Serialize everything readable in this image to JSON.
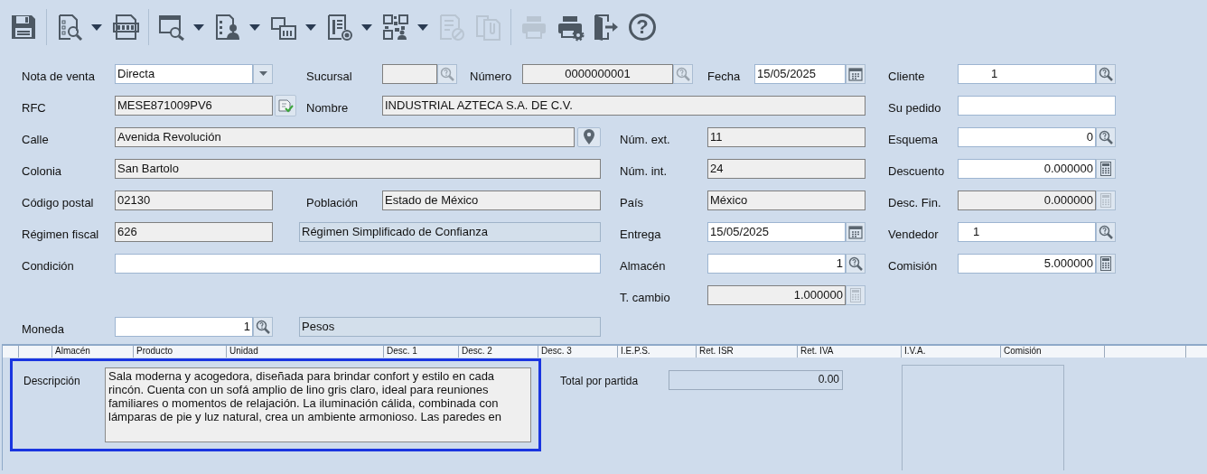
{
  "toolbar": {
    "groups": [
      [
        {
          "disabled": false,
          "dropdown": false
        }
      ],
      [
        {
          "disabled": false,
          "dropdown": true
        },
        {
          "disabled": false,
          "dropdown": false
        }
      ],
      [
        {
          "disabled": false,
          "dropdown": true
        },
        {
          "disabled": false,
          "dropdown": true
        },
        {
          "disabled": false,
          "dropdown": true
        },
        {
          "disabled": false,
          "dropdown": true
        },
        {
          "disabled": false,
          "dropdown": true
        },
        {
          "disabled": true,
          "dropdown": false
        },
        {
          "disabled": true,
          "dropdown": false
        }
      ],
      [
        {
          "disabled": true,
          "dropdown": false
        },
        {
          "disabled": false,
          "dropdown": false
        },
        {
          "disabled": false,
          "dropdown": false
        },
        {
          "disabled": false,
          "dropdown": false,
          "label": "?"
        }
      ]
    ]
  },
  "form": [
    {
      "kind": "label",
      "text": "Nota de venta"
    },
    {
      "kind": "combo",
      "value": "Directa",
      "readonly": false
    },
    {
      "kind": "label",
      "text": "Sucursal"
    },
    {
      "kind": "lookup",
      "readonly": true
    },
    {
      "kind": "label",
      "text": "Número"
    },
    {
      "kind": "lookup",
      "value": "0000000001",
      "readonly": true
    },
    {
      "kind": "label",
      "text": "Fecha"
    },
    {
      "kind": "date",
      "value": "15/05/2025",
      "readonly": false
    },
    {
      "kind": "label",
      "text": "Cliente"
    },
    {
      "kind": "lookup",
      "value": "1",
      "readonly": false
    },
    {
      "kind": "label",
      "text": "RFC"
    },
    {
      "kind": "text",
      "value": "MESE871009PV6",
      "readonly": true
    },
    {
      "kind": "check-button"
    },
    {
      "kind": "label",
      "text": "Nombre"
    },
    {
      "kind": "text",
      "value": "INDUSTRIAL AZTECA S.A. DE C.V.",
      "readonly": true
    },
    {
      "kind": "label",
      "text": "Su pedido"
    },
    {
      "kind": "text",
      "readonly": false
    },
    {
      "kind": "label",
      "text": "Calle"
    },
    {
      "kind": "pin",
      "value": "Avenida Revolución",
      "readonly": true
    },
    {
      "kind": "label",
      "text": "Núm. ext."
    },
    {
      "kind": "text",
      "value": "11",
      "readonly": true
    },
    {
      "kind": "label",
      "text": "Esquema"
    },
    {
      "kind": "lookup",
      "value": "0",
      "readonly": false
    },
    {
      "kind": "label",
      "text": "Colonia"
    },
    {
      "kind": "text",
      "value": "San Bartolo",
      "readonly": true
    },
    {
      "kind": "label",
      "text": "Núm. int."
    },
    {
      "kind": "text",
      "value": "24",
      "readonly": true
    },
    {
      "kind": "label",
      "text": "Descuento"
    },
    {
      "kind": "calc",
      "value": "0.000000",
      "readonly": false
    },
    {
      "kind": "label",
      "text": "Código postal"
    },
    {
      "kind": "text",
      "value": "02130",
      "readonly": true
    },
    {
      "kind": "label",
      "text": "Población"
    },
    {
      "kind": "text",
      "value": "Estado de México",
      "readonly": true
    },
    {
      "kind": "label",
      "text": "País"
    },
    {
      "kind": "text",
      "value": "México",
      "readonly": true
    },
    {
      "kind": "label",
      "text": "Desc. Fin."
    },
    {
      "kind": "calc",
      "value": "0.000000",
      "readonly": true
    },
    {
      "kind": "label",
      "text": "Régimen fiscal"
    },
    {
      "kind": "text",
      "value": "626",
      "readonly": true
    },
    {
      "kind": "panel",
      "value": "Régimen Simplificado de Confianza"
    },
    {
      "kind": "label",
      "text": "Entrega"
    },
    {
      "kind": "date",
      "value": "15/05/2025",
      "readonly": false
    },
    {
      "kind": "label",
      "text": "Vendedor"
    },
    {
      "kind": "lookup",
      "value": "1",
      "readonly": false
    },
    {
      "kind": "label",
      "text": "Condición"
    },
    {
      "kind": "text",
      "readonly": false
    },
    {
      "kind": "label",
      "text": "Almacén"
    },
    {
      "kind": "lookup",
      "value": "1",
      "readonly": false
    },
    {
      "kind": "label",
      "text": "Comisión"
    },
    {
      "kind": "calc",
      "value": "5.000000",
      "readonly": false
    },
    {
      "kind": "label",
      "text": "T. cambio"
    },
    {
      "kind": "calc",
      "value": "1.000000",
      "readonly": true
    },
    {
      "kind": "label",
      "text": "Moneda"
    },
    {
      "kind": "lookup",
      "value": "1",
      "readonly": false
    },
    {
      "kind": "panel",
      "value": "Pesos"
    }
  ],
  "grid": {
    "columns": [
      {},
      {},
      {
        "label": "Almacén"
      },
      {
        "label": "Producto"
      },
      {
        "label": "Unidad"
      },
      {
        "label": "Desc. 1"
      },
      {
        "label": "Desc. 2"
      },
      {
        "label": "Desc. 3"
      },
      {
        "label": "I.E.P.S."
      },
      {
        "label": "Ret. ISR"
      },
      {
        "label": "Ret. IVA"
      },
      {
        "label": "I.V.A."
      },
      {
        "label": "Comisión"
      },
      {}
    ]
  },
  "detail": {
    "description_label": "Descripción",
    "description": "Sala moderna y acogedora, diseñada para brindar confort y estilo en cada rincón. Cuenta con un sofá amplio de lino gris claro, ideal para reuniones familiares o momentos de relajación. La iluminación cálida, combinada con lámparas de pie y luz natural, crea un ambiente armonioso. Las paredes en",
    "total_label": "Total por partida",
    "total": "0.00"
  }
}
